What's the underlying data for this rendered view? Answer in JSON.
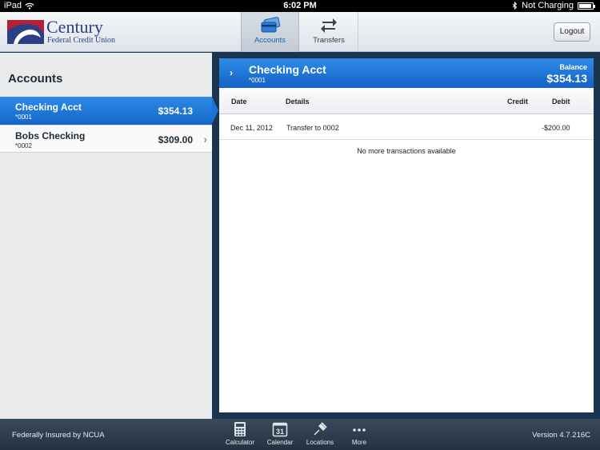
{
  "status_bar": {
    "device": "iPad",
    "time": "6:02 PM",
    "charging": "Not Charging",
    "battery_level": 0.95
  },
  "brand": {
    "name": "Century",
    "subtitle": "Federal Credit Union",
    "colors": {
      "navy": "#2a3f86",
      "red": "#b22234"
    }
  },
  "nav": {
    "tabs": [
      {
        "label": "Accounts",
        "icon": "cards-icon",
        "active": true
      },
      {
        "label": "Transfers",
        "icon": "transfer-arrows-icon",
        "active": false
      }
    ],
    "logout_label": "Logout"
  },
  "accounts_panel": {
    "title": "Accounts",
    "accounts": [
      {
        "name": "Checking Acct",
        "number": "*0001",
        "balance": "$354.13",
        "selected": true
      },
      {
        "name": "Bobs Checking",
        "number": "*0002",
        "balance": "$309.00",
        "selected": false
      }
    ]
  },
  "detail": {
    "account_name": "Checking Acct",
    "account_number": "*0001",
    "balance_label": "Balance",
    "balance": "$354.13",
    "columns": {
      "date": "Date",
      "details": "Details",
      "credit": "Credit",
      "debit": "Debit"
    },
    "transactions": [
      {
        "date": "Dec 11, 2012",
        "details": "Transfer to 0002",
        "credit": "",
        "debit": "-$200.00"
      }
    ],
    "no_more_text": "No more transactions available"
  },
  "bottom_bar": {
    "left_text": "Federally Insured by NCUA",
    "version": "Version 4.7.216C",
    "items": [
      {
        "label": "Calculator",
        "icon": "calculator-icon"
      },
      {
        "label": "Calendar",
        "icon": "calendar-icon",
        "icon_text": "31"
      },
      {
        "label": "Locations",
        "icon": "location-pin-icon"
      },
      {
        "label": "More",
        "icon": "more-dots-icon"
      }
    ]
  },
  "colors": {
    "accent": "#1a72d4",
    "panel_bg": "#1b3550"
  }
}
